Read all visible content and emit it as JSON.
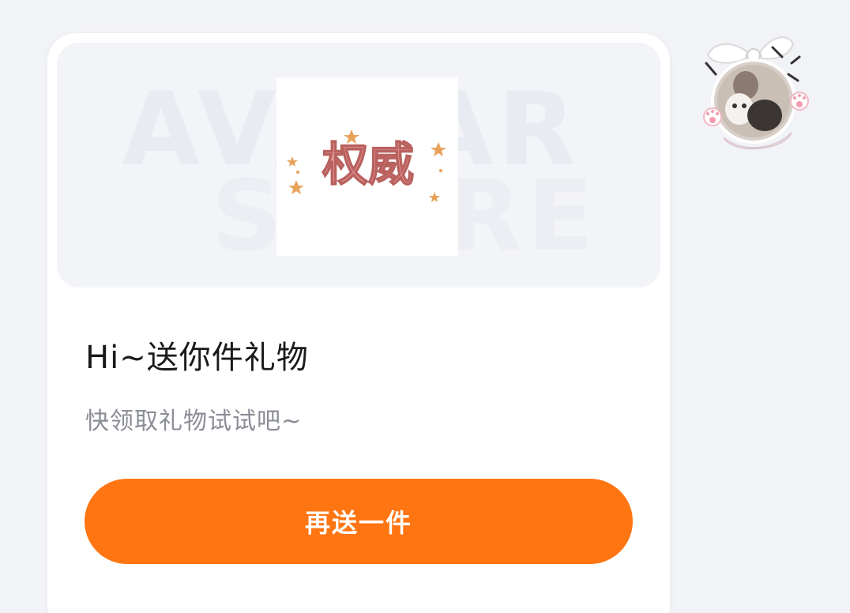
{
  "gift_card": {
    "banner_watermark_line1": "AVATAR",
    "banner_watermark_line2": "STORE",
    "product_label": "权威",
    "title": "Hi~送你件礼物",
    "subtitle": "快领取礼物试试吧~",
    "button_label": "再送一件"
  },
  "colors": {
    "accent": "#ff7512",
    "background": "#f2f3f7",
    "card": "#ffffff",
    "title_text": "#1a1a1a",
    "subtitle_text": "#8a8d95",
    "product_text": "#e79a98"
  },
  "icons": {
    "avatar": "user-avatar-with-cat-ear-frame"
  }
}
